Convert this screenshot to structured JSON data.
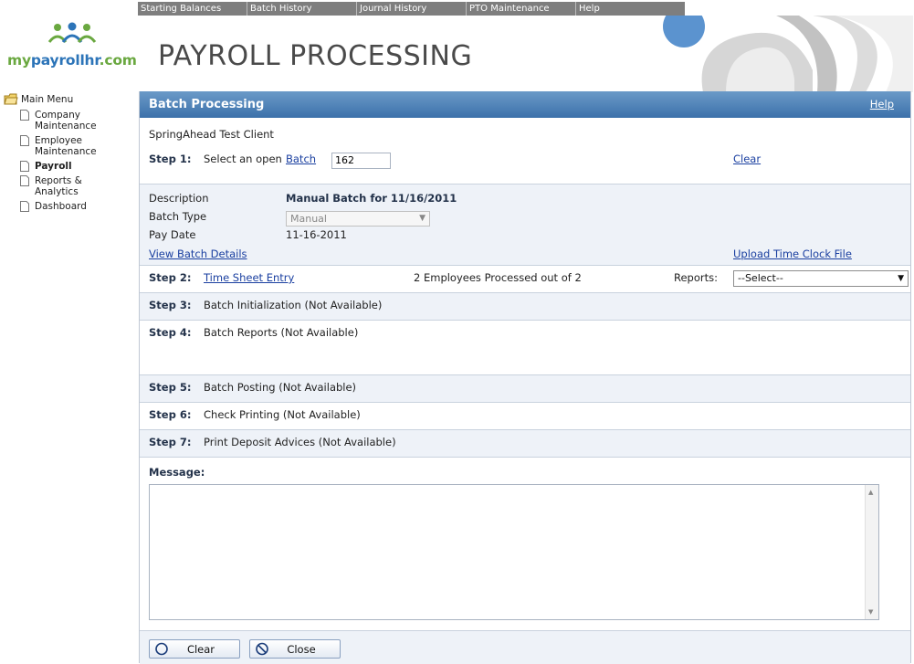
{
  "logo": {
    "part_my": "my",
    "part_mid": "payrollhr",
    "part_end": ".com"
  },
  "topnav": [
    "Starting Balances",
    "Batch History",
    "Journal History",
    "PTO Maintenance",
    "Help"
  ],
  "page_title": "PAYROLL PROCESSING",
  "sidebar": {
    "root": "Main Menu",
    "items": [
      {
        "label": "Company Maintenance",
        "line1": "Company",
        "line2": "Maintenance"
      },
      {
        "label": "Employee Maintenance",
        "line1": "Employee",
        "line2": "Maintenance"
      },
      {
        "label": "Payroll",
        "line1": "Payroll",
        "line2": ""
      },
      {
        "label": "Reports & Analytics",
        "line1": "Reports &",
        "line2": "Analytics"
      },
      {
        "label": "Dashboard",
        "line1": "Dashboard",
        "line2": ""
      }
    ]
  },
  "panel": {
    "title": "Batch Processing",
    "help": "Help"
  },
  "client_name": "SpringAhead Test Client",
  "step1": {
    "label": "Step 1:",
    "text": "Select an open",
    "link": "Batch",
    "batch_value": "162",
    "clear": "Clear"
  },
  "batch": {
    "description_label": "Description",
    "description_value": "Manual Batch for 11/16/2011",
    "type_label": "Batch Type",
    "type_value": "Manual",
    "pay_date_label": "Pay Date",
    "pay_date_value": "11-16-2011",
    "view_details": "View Batch Details",
    "upload": "Upload Time Clock File"
  },
  "step2": {
    "label": "Step 2:",
    "link": "Time Sheet Entry",
    "processed": "2 Employees Processed out of 2",
    "reports_label": "Reports:",
    "reports_value": "--Select--"
  },
  "step3": {
    "label": "Step 3:",
    "text": "Batch Initialization (Not Available)"
  },
  "step4": {
    "label": "Step 4:",
    "text": "Batch Reports (Not Available)"
  },
  "step5": {
    "label": "Step 5:",
    "text": "Batch Posting (Not Available)"
  },
  "step6": {
    "label": "Step 6:",
    "text": "Check Printing (Not Available)"
  },
  "step7": {
    "label": "Step 7:",
    "text": "Print Deposit Advices (Not Available)"
  },
  "message": {
    "label": "Message:",
    "value": ""
  },
  "buttons": {
    "clear": "Clear",
    "close": "Close"
  },
  "colors": {
    "header_blue": "#3c71aa",
    "nav_gray": "#7e7e7e",
    "link_blue": "#1a3fa0",
    "logo_green": "#6aa840",
    "logo_blue": "#2c74b8"
  }
}
